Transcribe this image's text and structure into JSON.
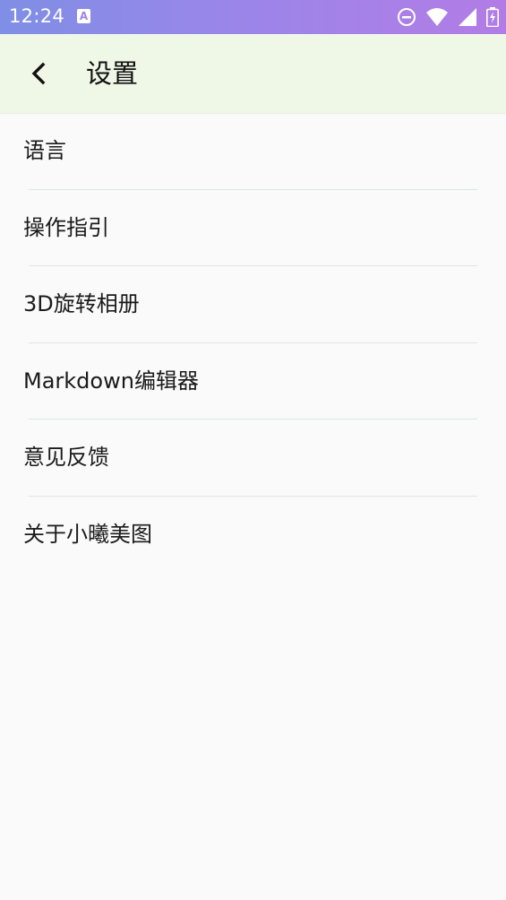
{
  "status_bar": {
    "time": "12:24",
    "notification_badge": "A",
    "icons": [
      "do-not-disturb-icon",
      "wifi-icon",
      "signal-icon",
      "battery-charging-icon"
    ]
  },
  "header": {
    "title": "设置",
    "back_icon": "chevron-left-icon"
  },
  "menu": {
    "items": [
      {
        "label": "语言"
      },
      {
        "label": "操作指引"
      },
      {
        "label": "3D旋转相册"
      },
      {
        "label": "Markdown编辑器"
      },
      {
        "label": "意见反馈"
      },
      {
        "label": "关于小曦美图"
      }
    ]
  },
  "colors": {
    "status_bar_start": "#7f8ee6",
    "status_bar_end": "#b27ce6",
    "header_background": "#eff7e6",
    "page_background": "#fafafa",
    "divider": "#dde6e4"
  }
}
